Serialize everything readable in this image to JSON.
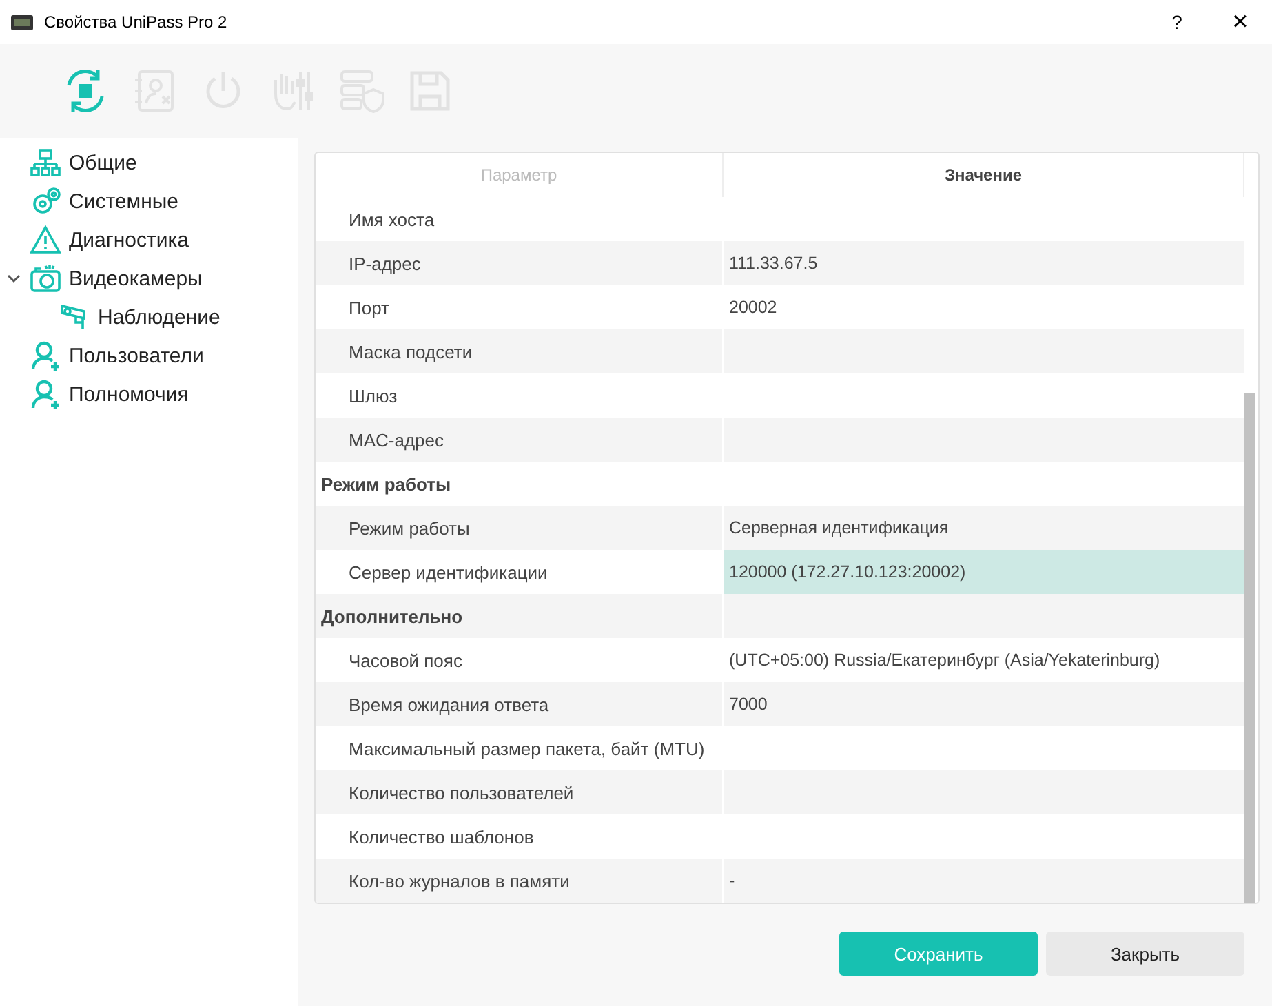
{
  "window": {
    "title": "Свойства UniPass Pro 2",
    "help": "?",
    "close": "×"
  },
  "toolbar": [
    {
      "disabled": false
    },
    {
      "disabled": true
    },
    {
      "disabled": true
    },
    {
      "disabled": true
    },
    {
      "disabled": true
    },
    {
      "disabled": true
    }
  ],
  "sidebar": {
    "items": [
      {
        "label": "Общие"
      },
      {
        "label": "Системные"
      },
      {
        "label": "Диагностика"
      },
      {
        "label": "Видеокамеры",
        "expanded": true,
        "children": [
          {
            "label": "Наблюдение"
          }
        ]
      },
      {
        "label": "Пользователи"
      },
      {
        "label": "Полномочия"
      }
    ]
  },
  "table": {
    "columns": [
      "Параметр",
      "Значение"
    ],
    "rows": [
      {
        "kind": "param",
        "name": "Имя хоста",
        "selected": false
      },
      {
        "kind": "param",
        "name": "IP-адрес",
        "value": "111.33.67.5",
        "selected": false
      },
      {
        "kind": "param",
        "name": "Порт",
        "value": "20002",
        "selected": false
      },
      {
        "kind": "param",
        "name": "Маска подсети",
        "selected": false
      },
      {
        "kind": "param",
        "name": "Шлюз",
        "selected": false
      },
      {
        "kind": "param",
        "name": "MAC-адрес",
        "selected": false
      },
      {
        "kind": "group",
        "name": "Режим работы",
        "selected": false
      },
      {
        "kind": "param",
        "name": "Режим работы",
        "value": "Серверная идентификация",
        "selected": false
      },
      {
        "kind": "param",
        "name": "Сервер идентификации",
        "value": "120000 (172.27.10.123:20002)",
        "selected": true
      },
      {
        "kind": "group",
        "name": "Дополнительно",
        "selected": false
      },
      {
        "kind": "param",
        "name": "Часовой пояс",
        "value": "(UTC+05:00) Russia/Екатеринбург (Asia/Yekaterinburg)",
        "selected": false
      },
      {
        "kind": "param",
        "name": "Время ожидания ответа",
        "value": "7000",
        "selected": false
      },
      {
        "kind": "param",
        "name": "Максимальный размер пакета, байт (MTU)",
        "selected": false
      },
      {
        "kind": "param",
        "name": "Количество пользователей",
        "selected": false
      },
      {
        "kind": "param",
        "name": "Количество шаблонов",
        "selected": false
      },
      {
        "kind": "param",
        "name": "Кол-во журналов в памяти",
        "value": "-",
        "selected": false
      }
    ]
  },
  "buttons": [
    {
      "label": "Сохранить",
      "kind": "primary"
    },
    {
      "label": "Закрыть",
      "kind": "secondary"
    }
  ]
}
